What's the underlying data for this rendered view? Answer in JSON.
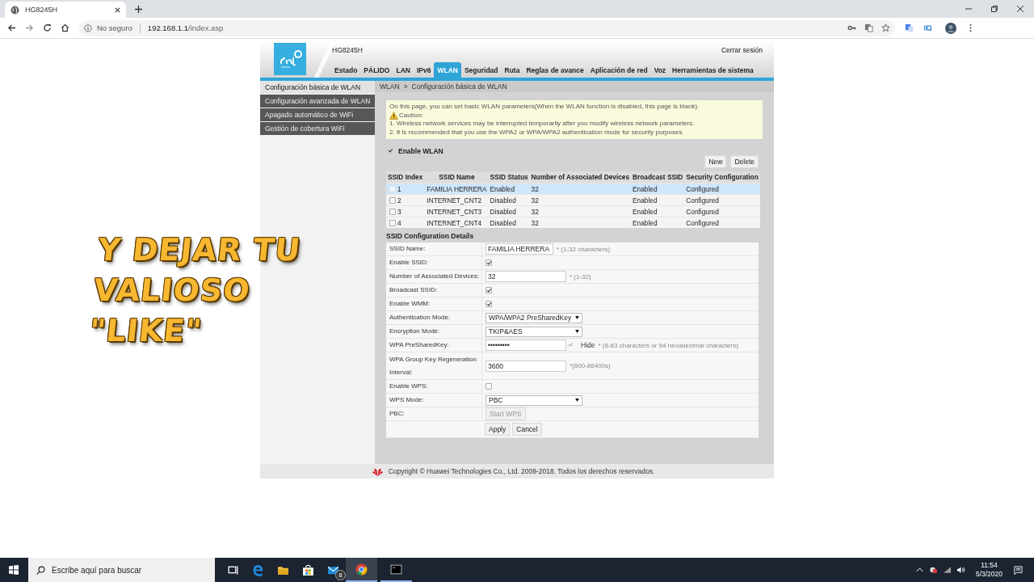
{
  "browser": {
    "tab_title": "HG8245H",
    "security_label": "No seguro",
    "url_host": "192.168.1.1",
    "url_path": "/index.asp"
  },
  "router": {
    "model": "HG8245H",
    "logout": "Cerrar sesión",
    "nav": [
      {
        "label": "Estado",
        "selected": false
      },
      {
        "label": "PÁLIDO",
        "selected": false
      },
      {
        "label": "LAN",
        "selected": false
      },
      {
        "label": "IPv6",
        "selected": false
      },
      {
        "label": "WLAN",
        "selected": true
      },
      {
        "label": "Seguridad",
        "selected": false
      },
      {
        "label": "Ruta",
        "selected": false
      },
      {
        "label": "Reglas de avance",
        "selected": false
      },
      {
        "label": "Aplicación de red",
        "selected": false
      },
      {
        "label": "Voz",
        "selected": false
      },
      {
        "label": "Herramientas de sistema",
        "selected": false
      }
    ],
    "sidebar": [
      {
        "label": "Configuración básica de WLAN",
        "selected": true
      },
      {
        "label": "Configuración avanzada de WLAN",
        "selected": false
      },
      {
        "label": "Apagado automático de WiFi",
        "selected": false
      },
      {
        "label": "Gestión de cobertura WiFi",
        "selected": false
      }
    ],
    "breadcrumb": [
      "WLAN",
      ">",
      "Configuración básica de WLAN"
    ],
    "notice": {
      "intro": "On this page, you can set basic WLAN parameters(When the WLAN function is disabled, this page is blank).",
      "caution": "Caution:",
      "items": [
        "1. Wireless network services may be interrupted temporarily after you modify wireless network parameters.",
        "2. It is recommended that you use the WPA2 or WPA/WPA2 authentication mode for security purposes."
      ]
    },
    "enable_wlan": {
      "label": "Enable WLAN",
      "checked": true
    },
    "table_buttons": [
      "New",
      "Delete"
    ],
    "table": {
      "columns": [
        "SSID Index",
        "SSID Name",
        "SSID Status",
        "Number of Associated Devices",
        "Broadcast SSID",
        "Security Configuration"
      ],
      "rows": [
        {
          "selected": true,
          "checked": false,
          "cells": [
            "1",
            "FAMILIA HERRERA",
            "Enabled",
            "32",
            "Enabled",
            "Configured"
          ]
        },
        {
          "selected": false,
          "checked": false,
          "cells": [
            "2",
            "INTERNET_CNT2",
            "Disabled",
            "32",
            "Enabled",
            "Configured"
          ]
        },
        {
          "selected": false,
          "checked": false,
          "cells": [
            "3",
            "INTERNET_CNT3",
            "Disabled",
            "32",
            "Enabled",
            "Configured"
          ]
        },
        {
          "selected": false,
          "checked": false,
          "cells": [
            "4",
            "INTERNET_CNT4",
            "Disabled",
            "32",
            "Enabled",
            "Configured"
          ]
        }
      ]
    },
    "details_title": "SSID Configuration Details",
    "fields": [
      {
        "kind": "text",
        "label": "SSID Name:",
        "value": "FAMILIA HERRERA",
        "hint": "* (1-32 characters)"
      },
      {
        "kind": "checkbox",
        "label": "Enable SSID:",
        "checked": true
      },
      {
        "kind": "text",
        "label": "Number of Associated Devices:",
        "value": "32",
        "hint": "* (1-32)"
      },
      {
        "kind": "checkbox",
        "label": "Broadcast SSID:",
        "checked": true
      },
      {
        "kind": "checkbox",
        "label": "Enable WMM:",
        "checked": true
      },
      {
        "kind": "select",
        "label": "Authentication Mode:",
        "value": "WPA/WPA2 PreSharedKey"
      },
      {
        "kind": "select",
        "label": "Encryption Mode:",
        "value": "TKIP&AES"
      },
      {
        "kind": "password",
        "label": "WPA PreSharedKey:",
        "value": "•••••••••",
        "checked": true,
        "hide_label": "Hide",
        "hint": "* (8-63 characters or 64 hexadecimal characters)"
      },
      {
        "kind": "text",
        "label": "WPA Group Key Regeneration Interval:",
        "value": "3600",
        "hint": "*(600-86400s)"
      },
      {
        "kind": "checkbox",
        "label": "Enable WPS:",
        "checked": false
      },
      {
        "kind": "select",
        "label": "WPS Mode:",
        "value": "PBC"
      },
      {
        "kind": "button",
        "label": "PBC:",
        "value": "Start WPS"
      }
    ],
    "actions": [
      "Apply",
      "Cancel"
    ],
    "footer": "Copyright © Huawei Technologies Co., Ltd. 2009-2018. Todos los derechos reservados."
  },
  "overlay_caption": [
    "Y DEJAR TU",
    "VALIOSO",
    "\"LIKE\""
  ],
  "taskbar": {
    "search_placeholder": "Escribe aquí para buscar",
    "mail_badge": "8",
    "time": "11:54",
    "date": "5/3/2020"
  }
}
